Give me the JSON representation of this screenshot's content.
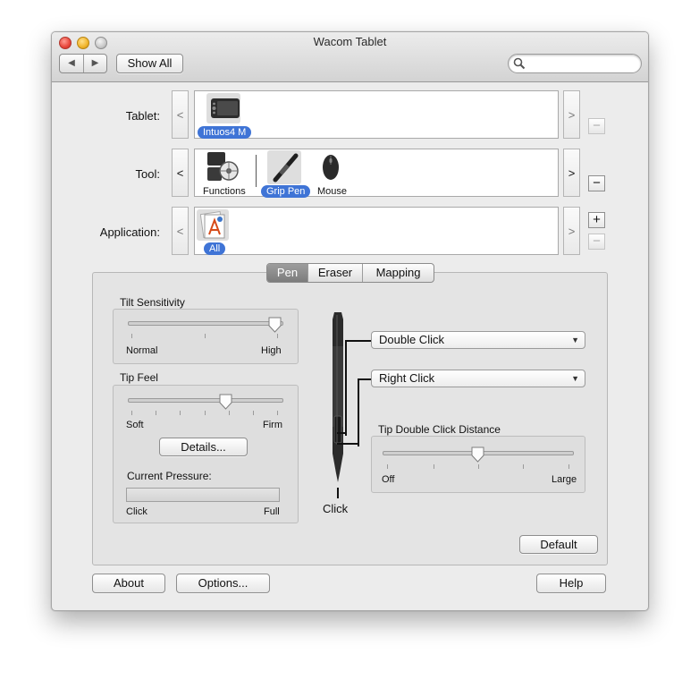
{
  "window": {
    "title": "Wacom Tablet"
  },
  "toolbar": {
    "back": "◀",
    "forward": "▶",
    "show_all": "Show All",
    "search_placeholder": ""
  },
  "rows": {
    "tablet": {
      "label": "Tablet:",
      "item": "Intuos4 M"
    },
    "tool": {
      "label": "Tool:",
      "items": [
        "Functions",
        "Grip Pen",
        "Mouse"
      ],
      "selected": "Grip Pen"
    },
    "application": {
      "label": "Application:",
      "item": "All"
    },
    "prev": "<",
    "next": ">",
    "minus": "−",
    "plus": "+"
  },
  "tabs": [
    "Pen",
    "Eraser",
    "Mapping"
  ],
  "active_tab": "Pen",
  "tilt": {
    "label": "Tilt Sensitivity",
    "min": "Normal",
    "max": "High",
    "value": 1.0
  },
  "tip_feel": {
    "label": "Tip Feel",
    "min": "Soft",
    "max": "Firm",
    "value": 0.65,
    "details": "Details..."
  },
  "pressure": {
    "label": "Current Pressure:",
    "min": "Click",
    "max": "Full",
    "value": 0.0
  },
  "pen_buttons": {
    "upper": "Double Click",
    "lower": "Right Click",
    "tip": "Click"
  },
  "double_click_distance": {
    "label": "Tip Double Click Distance",
    "min": "Off",
    "max": "Large",
    "value": 0.5
  },
  "buttons": {
    "default": "Default",
    "about": "About",
    "options": "Options...",
    "help": "Help"
  },
  "colors": {
    "selection": "#3f74d6",
    "window_bg": "#ececec"
  }
}
